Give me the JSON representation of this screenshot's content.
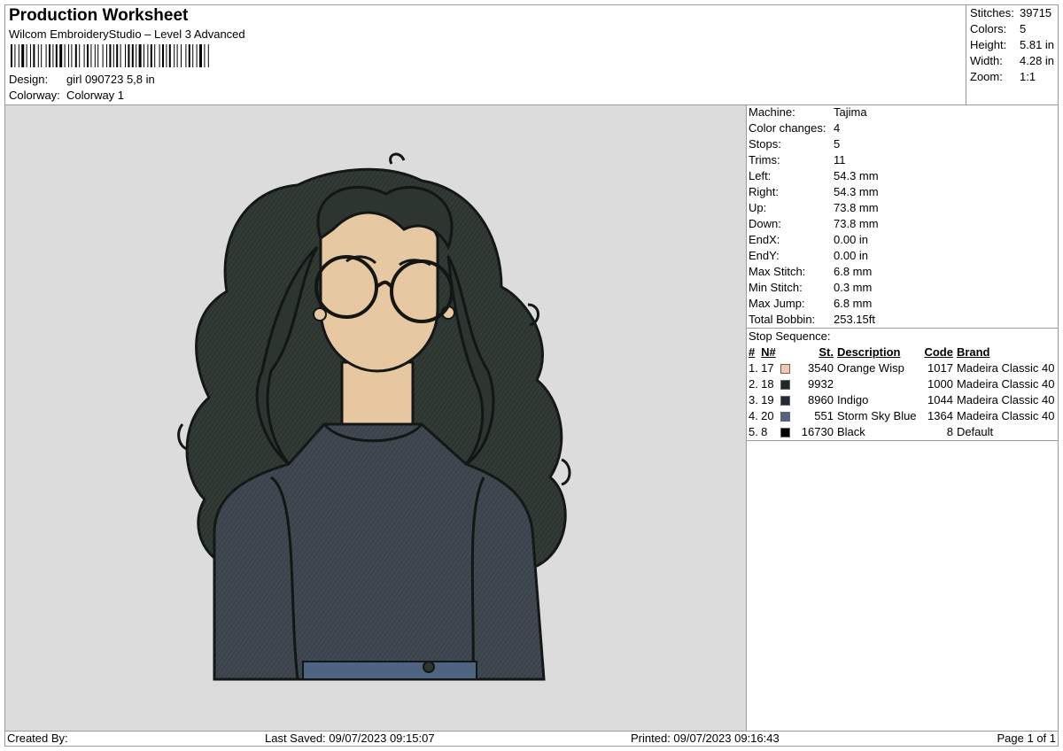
{
  "header": {
    "title": "Production Worksheet",
    "subtitle": "Wilcom EmbroideryStudio – Level 3 Advanced",
    "design_label": "Design:",
    "design_value": "girl 090723 5,8 in",
    "colorway_label": "Colorway:",
    "colorway_value": "Colorway 1"
  },
  "summary": [
    {
      "label": "Stitches:",
      "value": "39715"
    },
    {
      "label": "Colors:",
      "value": "5"
    },
    {
      "label": "Height:",
      "value": "5.81 in"
    },
    {
      "label": "Width:",
      "value": "4.28 in"
    },
    {
      "label": "Zoom:",
      "value": "1:1"
    }
  ],
  "details": [
    {
      "label": "Machine:",
      "value": "Tajima"
    },
    {
      "label": "Color changes:",
      "value": "4"
    },
    {
      "label": "Stops:",
      "value": "5"
    },
    {
      "label": "Trims:",
      "value": "11"
    },
    {
      "label": "Left:",
      "value": "54.3 mm"
    },
    {
      "label": "Right:",
      "value": "54.3 mm"
    },
    {
      "label": "Up:",
      "value": "73.8 mm"
    },
    {
      "label": "Down:",
      "value": "73.8 mm"
    },
    {
      "label": "EndX:",
      "value": "0.00 in"
    },
    {
      "label": "EndY:",
      "value": "0.00 in"
    },
    {
      "label": "Max Stitch:",
      "value": "6.8 mm"
    },
    {
      "label": "Min Stitch:",
      "value": "0.3 mm"
    },
    {
      "label": "Max Jump:",
      "value": "6.8 mm"
    },
    {
      "label": "Total Bobbin:",
      "value": "253.15ft"
    }
  ],
  "stop_sequence": {
    "heading": "Stop Sequence:",
    "columns": {
      "idx": "#",
      "n": "N#",
      "st": "St.",
      "desc": "Description",
      "code": "Code",
      "brand": "Brand"
    },
    "rows": [
      {
        "idx": "1.",
        "n": "17",
        "color": "#f5c6a8",
        "st": "3540",
        "desc": "Orange Wisp",
        "code": "1017",
        "brand": "Madeira Classic 40"
      },
      {
        "idx": "2.",
        "n": "18",
        "color": "#1f2a28",
        "st": "9932",
        "desc": "",
        "code": "1000",
        "brand": "Madeira Classic 40"
      },
      {
        "idx": "3.",
        "n": "19",
        "color": "#222a36",
        "st": "8960",
        "desc": "Indigo",
        "code": "1044",
        "brand": "Madeira Classic 40"
      },
      {
        "idx": "4.",
        "n": "20",
        "color": "#4e6483",
        "st": "551",
        "desc": "Storm Sky Blue",
        "code": "1364",
        "brand": "Madeira Classic 40"
      },
      {
        "idx": "5.",
        "n": "8",
        "color": "#000000",
        "st": "16730",
        "desc": "Black",
        "code": "8",
        "brand": "Default"
      }
    ]
  },
  "footer": {
    "created_by": "Created By:",
    "last_saved": "Last Saved: 09/07/2023 09:15:07",
    "printed": "Printed: 09/07/2023 09:16:43",
    "page": "Page 1 of 1"
  },
  "colors": {
    "preview_bg": "#dcdcdc",
    "hair": "#2d3530",
    "skin": "#e6c7a0",
    "sweater": "#3b444c",
    "outline": "#121614"
  }
}
